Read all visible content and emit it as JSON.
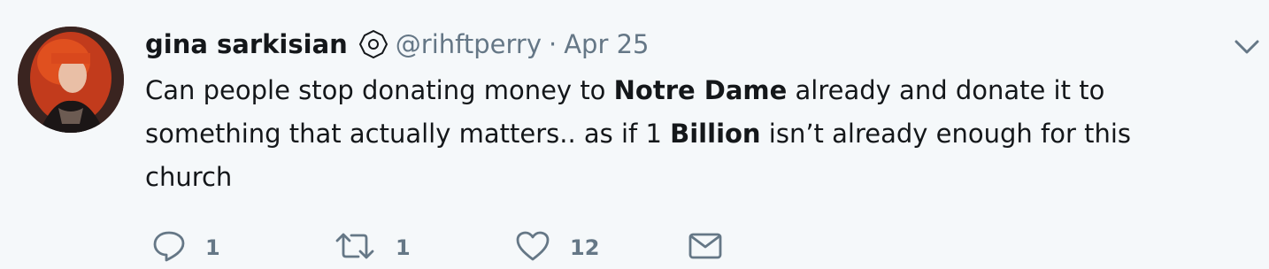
{
  "tweet": {
    "author_name": "gina sarkisian",
    "handle": "@rihftperry",
    "separator": "·",
    "timestamp": "Apr 25",
    "text_parts": [
      "Can people stop donating money to ",
      "Notre Dame",
      " already and donate it to something that actually matters.. as if 1 ",
      "Billion",
      " isn’t already enough for this church"
    ]
  },
  "actions": {
    "reply_count": "1",
    "retweet_count": "1",
    "like_count": "12"
  },
  "icons": {
    "badge": "profile-badge-icon",
    "caret": "chevron-down-icon",
    "reply": "reply-icon",
    "retweet": "retweet-icon",
    "like": "heart-icon",
    "dm": "envelope-icon"
  },
  "colors": {
    "background": "#f5f8fa",
    "text": "#14171a",
    "secondary": "#657786"
  }
}
